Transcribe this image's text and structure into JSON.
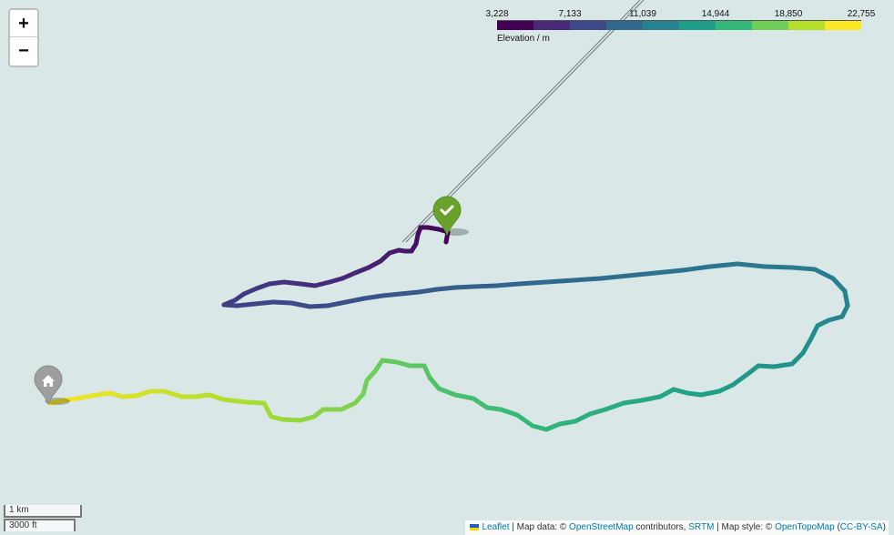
{
  "zoom": {
    "in_label": "+",
    "out_label": "−"
  },
  "legend": {
    "ticks": [
      "3,228",
      "7,133",
      "11,039",
      "14,944",
      "18,850",
      "22,755"
    ],
    "title": "Elevation / m",
    "colors": [
      "#440154",
      "#482878",
      "#3e4989",
      "#31688e",
      "#26828e",
      "#1f9e89",
      "#35b779",
      "#6ece58",
      "#b5de2b",
      "#fde725"
    ]
  },
  "scale": {
    "metric": "1 km",
    "imperial": "3000 ft"
  },
  "markers": {
    "start": "home-icon",
    "end": "checkmark-icon",
    "start_color": "#9e9e9e",
    "end_color": "#6aa12a"
  },
  "attribution": {
    "leaflet": "Leaflet",
    "sep1": " | Map data: © ",
    "osm": "OpenStreetMap",
    "contributors": " contributors, ",
    "srtm": "SRTM",
    "style": " | Map style: © ",
    "opentopo": "OpenTopoMap",
    "open_paren": " (",
    "license": "CC-BY-SA",
    "close_paren": ")"
  }
}
